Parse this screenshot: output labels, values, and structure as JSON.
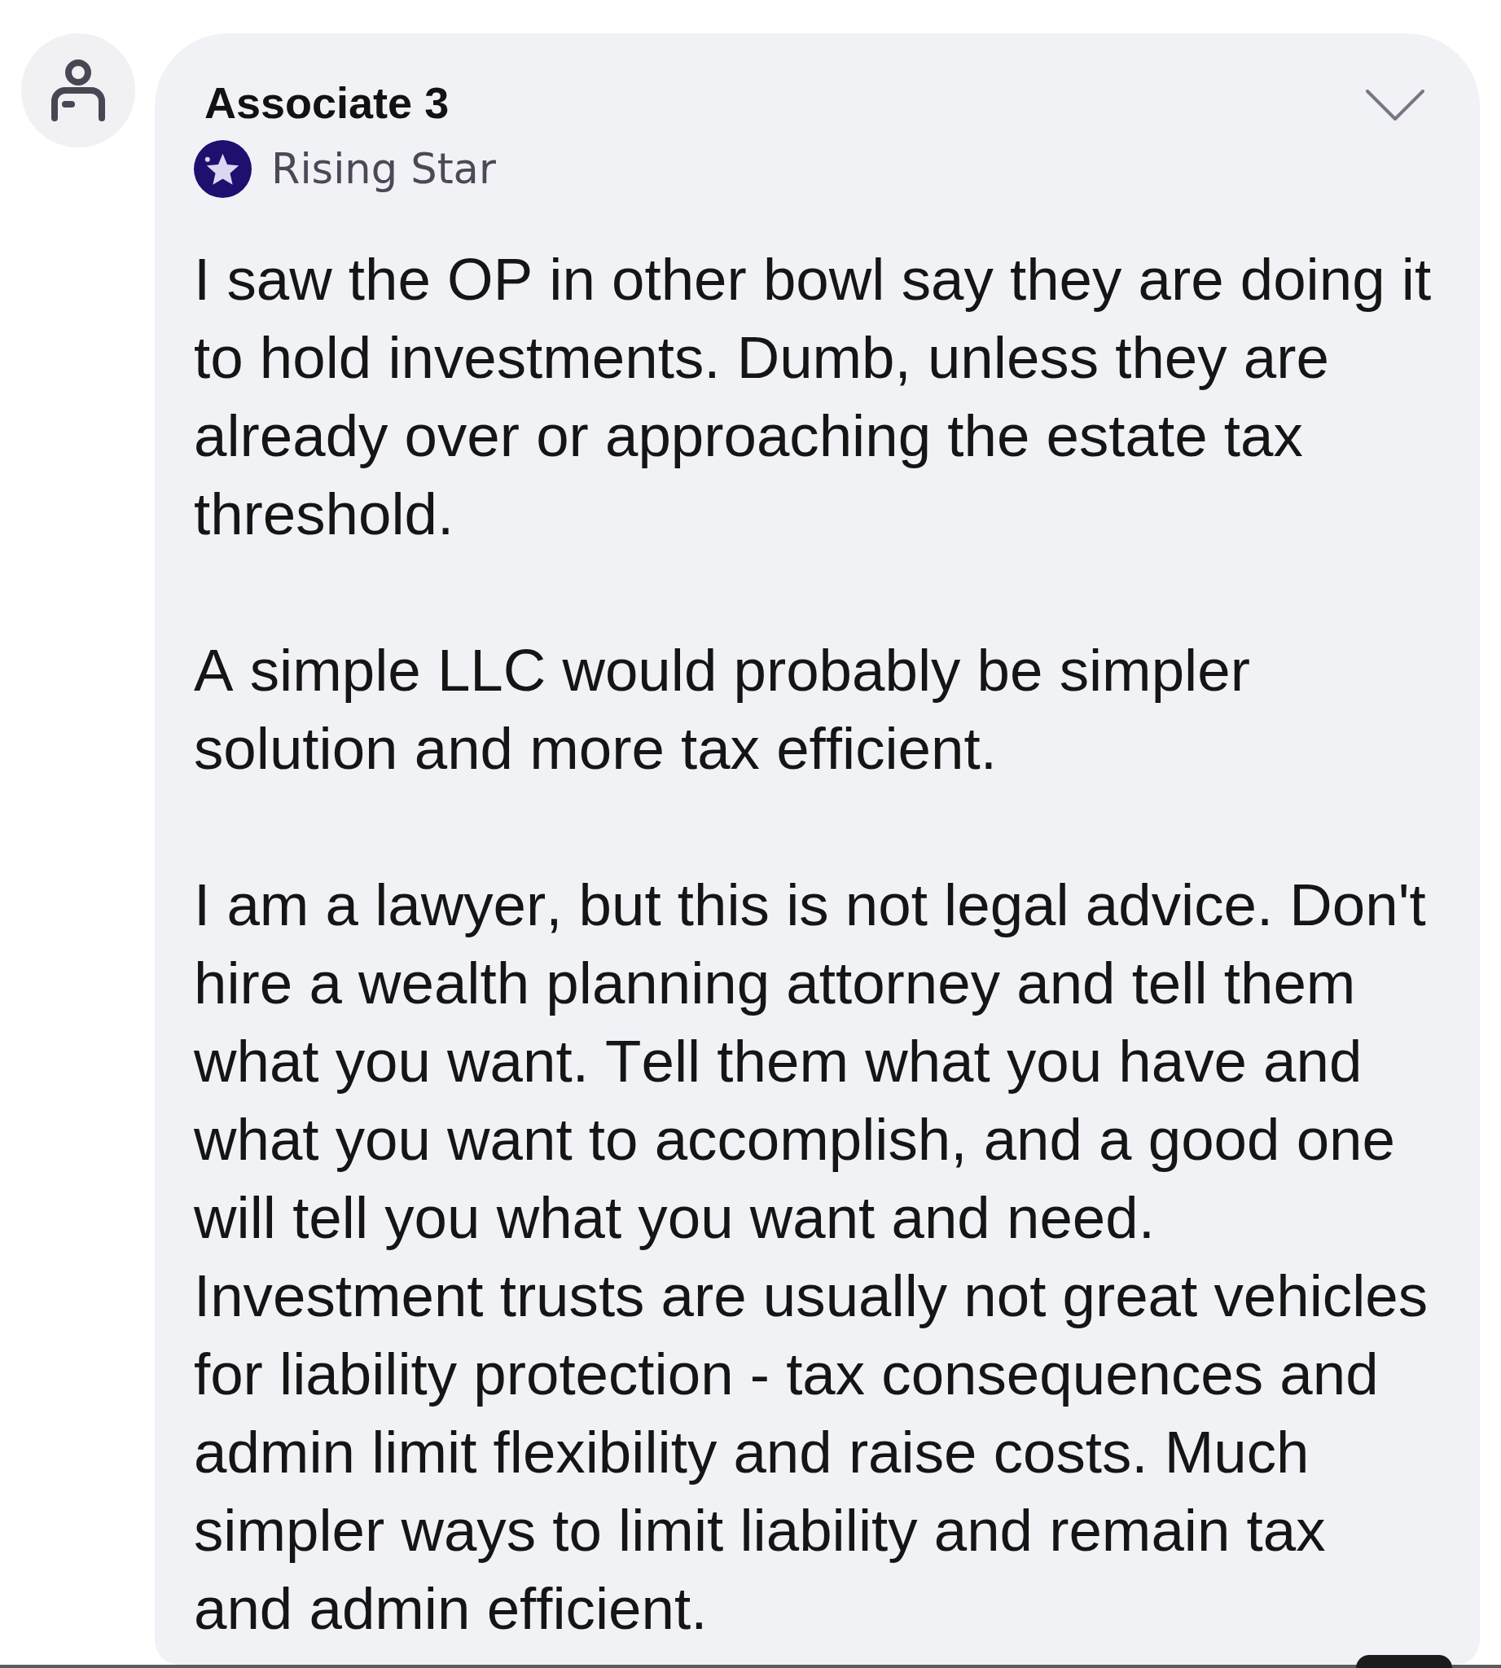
{
  "comment": {
    "author": "Associate 3",
    "badge": "Rising Star",
    "paragraphs": [
      "I saw the OP in other bowl say they are doing it to hold investments. Dumb, unless they are already over or approaching the estate tax threshold.",
      "A simple LLC would probably be simpler solution and more tax efficient.",
      "I am a lawyer, but this is not legal advice. Don't hire a wealth planning attorney and tell them what you want. Tell them what you have and what you want to accomplish, and a good one will tell you what you want and need.\nInvestment trusts are usually not great vehicles for liability protection - tax consequences and admin limit flexibility and raise costs. Much simpler ways to limit liability and remain tax and admin efficient."
    ]
  }
}
